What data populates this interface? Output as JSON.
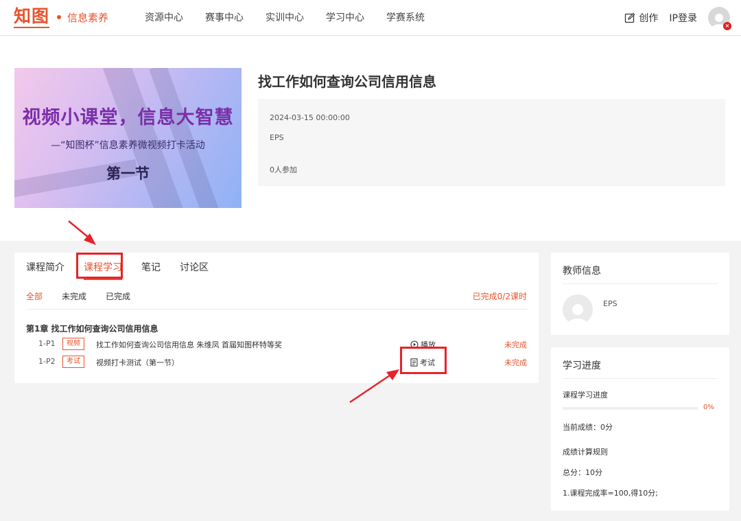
{
  "header": {
    "logo_text": "知图",
    "logo_sub": "信息素养",
    "nav": [
      "资源中心",
      "赛事中心",
      "实训中心",
      "学习中心",
      "学赛系统"
    ],
    "create_label": "创作",
    "login_label": "IP登录"
  },
  "course": {
    "banner_title": "视频小课堂，信息大智慧",
    "banner_subtitle": "—“知图杯”信息素养微视频打卡活动",
    "banner_section": "第一节",
    "title": "找工作如何查询公司信用信息",
    "date": "2024-03-15 00:00:00",
    "author": "EPS",
    "participants": "0人参加"
  },
  "tabs": [
    "课程简介",
    "课程学习",
    "笔记",
    "讨论区"
  ],
  "active_tab": 1,
  "filters": [
    "全部",
    "未完成",
    "已完成"
  ],
  "active_filter": 0,
  "completed_count": "已完成0/2课时",
  "chapter": {
    "title": "第1章 找工作如何查询公司信用信息",
    "lessons": [
      {
        "id": "1-P1",
        "tag": "视频",
        "name": "找工作如何查询公司信用信息 朱维凤 首届知图杯特等奖",
        "action": "播放",
        "status": "未完成"
      },
      {
        "id": "1-P2",
        "tag": "考试",
        "name": "视频打卡测试（第一节）",
        "action": "考试",
        "status": "未完成"
      }
    ]
  },
  "teacher": {
    "title": "教师信息",
    "name": "EPS"
  },
  "progress": {
    "title": "学习进度",
    "course_progress_label": "课程学习进度",
    "percent_label": "0%",
    "percent_value": 0,
    "current_score": "当前成绩：0分",
    "rule_title": "成绩计算规则",
    "total": "总分：10分",
    "rule_1": "1.课程完成率=100,得10分;"
  },
  "colors": {
    "accent": "#e8532b",
    "highlight": "#e8212a",
    "page_bg": "#f3f3f3"
  }
}
